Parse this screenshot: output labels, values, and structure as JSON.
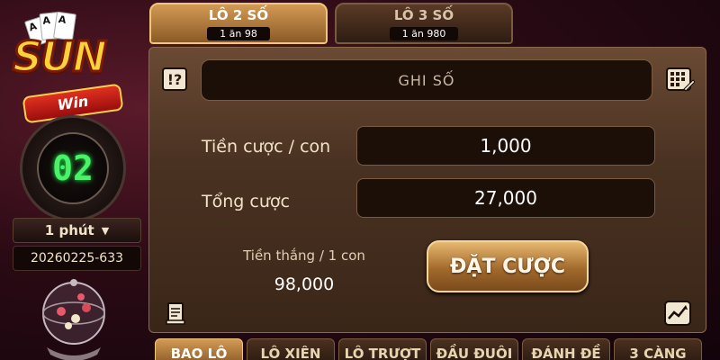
{
  "logo": {
    "brand_top": "SUN",
    "brand_bottom": "Win"
  },
  "timer": {
    "countdown": "02"
  },
  "period": {
    "label": "1 phút"
  },
  "session": {
    "id": "20260225-633"
  },
  "tabs": [
    {
      "label": "LÔ 2 SỐ",
      "odds": "1 ăn 98",
      "active": true
    },
    {
      "label": "LÔ 3 SỐ",
      "odds": "1 ăn 980",
      "active": false
    }
  ],
  "input": {
    "placeholder": "GHI SỐ"
  },
  "bet_per_unit": {
    "label": "Tiền cược / con",
    "value": "1,000"
  },
  "total_bet": {
    "label": "Tổng cược",
    "value": "27,000"
  },
  "win_per_unit": {
    "label": "Tiền thắng / 1 con",
    "value": "98,000"
  },
  "place_bet_button": {
    "label": "ĐẶT CƯỢC"
  },
  "bottom_tabs": [
    {
      "label": "BAO LÔ",
      "active": true
    },
    {
      "label": "LÔ XIÊN",
      "active": false
    },
    {
      "label": "LÔ TRƯỢT",
      "active": false
    },
    {
      "label": "ĐẦU ĐUÔI",
      "active": false
    },
    {
      "label": "ĐÁNH ĐỀ",
      "active": false
    },
    {
      "label": "3 CÀNG",
      "active": false
    }
  ],
  "colors": {
    "accent_gold": "#d39a55",
    "timer_green": "#49f268",
    "panel_brown": "#4a3222"
  },
  "icons": {
    "help": "help-icon",
    "keypad": "keypad-icon",
    "note": "note-icon",
    "chart": "chart-icon"
  }
}
